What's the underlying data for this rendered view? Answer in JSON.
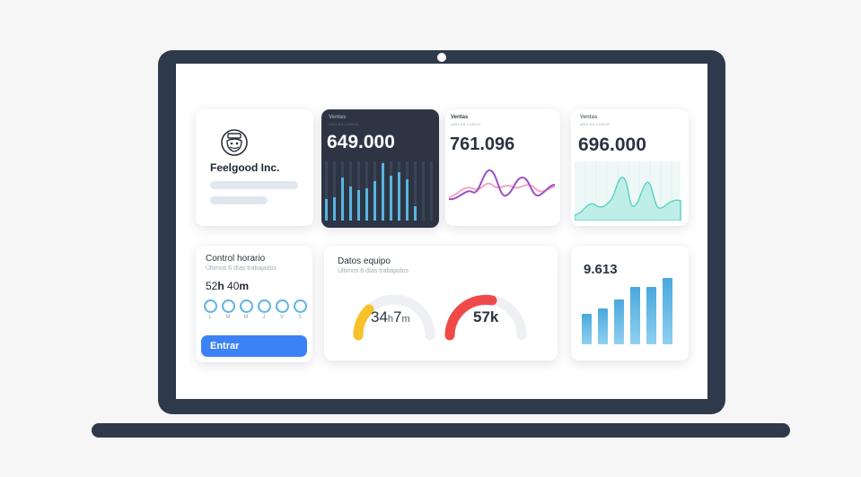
{
  "company": {
    "name": "Feelgood Inc."
  },
  "sales_dark": {
    "label": "Ventas",
    "sublabel": "AÑO EN CURSO",
    "value": "649.000"
  },
  "sales_line": {
    "label": "Ventas",
    "sublabel": "AÑO EN CURSO",
    "value": "761.096"
  },
  "sales_area": {
    "label": "Ventas",
    "sublabel": "AÑO EN CURSO",
    "value": "696.000"
  },
  "control": {
    "title": "Control horario",
    "subtitle": "Últimos 6 días trabajados",
    "hours": "52",
    "h_unit": "h",
    "minutes": "40",
    "m_unit": "m",
    "days": [
      "L",
      "M",
      "M",
      "J",
      "V",
      "S"
    ],
    "button_label": "Entrar"
  },
  "equipo": {
    "title": "Datos equipo",
    "subtitle": "Últimos 6 días trabajados",
    "gauge1": {
      "hours": "34",
      "h_unit": "h",
      "minutes": "7",
      "m_unit": "m",
      "fraction": 0.35
    },
    "gauge2": {
      "value": "57k",
      "fraction": 0.55
    }
  },
  "bars_card": {
    "value": "9.613"
  },
  "colors": {
    "frame": "#2e3a4b",
    "accent_blue": "#3b82f6",
    "ring_blue": "#5bb5e4",
    "bar_blue": "#5ab4e0",
    "gauge_yellow": "#f7c12b",
    "gauge_red": "#ef4a4a",
    "teal": "#5fd3c4",
    "purple": "#9b4fc4",
    "pink": "#e9559b"
  }
}
